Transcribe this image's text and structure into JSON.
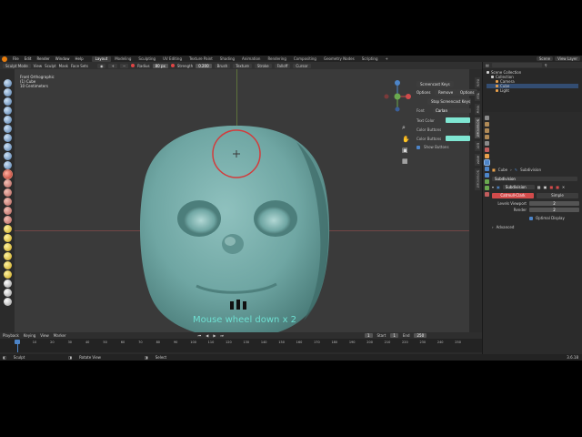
{
  "topbar": {
    "menu": [
      "File",
      "Edit",
      "Render",
      "Window",
      "Help"
    ],
    "workspaces": [
      "Layout",
      "Modeling",
      "Sculpting",
      "UV Editing",
      "Texture Paint",
      "Shading",
      "Animation",
      "Rendering",
      "Compositing",
      "Geometry Nodes",
      "Scripting"
    ],
    "active_workspace": "Layout",
    "scene": "Scene",
    "view_layer": "View Layer"
  },
  "viewport_header": {
    "mode": "Sculpt Mode",
    "menus": [
      "View",
      "Sculpt",
      "Mask",
      "Face Sets"
    ],
    "radius_label": "Radius",
    "radius_value": "80 px",
    "strength_label": "Strength",
    "strength_value": "0.200",
    "brush": "Brush",
    "texture": "Texture",
    "stroke": "Stroke",
    "falloff": "Falloff",
    "cursor": "Cursor"
  },
  "viewport": {
    "info_line1": "Front Orthographic",
    "info_line2": "(1) Cube",
    "info_line3": "10 Centimeters",
    "caption": "Mouse wheel down x 2"
  },
  "npanel": {
    "title": "Screencast Keys",
    "options": "Options",
    "remove": "Remove",
    "options2": "Options",
    "stop_button": "Stop Screencast Keys",
    "font_label": "Font",
    "font_value": "Carlan",
    "text_color_label": "Text Color",
    "text_color": "#7fe6d2",
    "color_buttons_label": "Color Buttons",
    "color_buttons": "#3a3a3a",
    "color_buttons2_label": "Color Buttons",
    "color_buttons2": "#7fe6d2",
    "show_buttons_label": "Show Buttons"
  },
  "side_tabs": [
    "Item",
    "Tool",
    "View",
    "Screencast",
    "Edit",
    "ANIM",
    "Screencast"
  ],
  "timeline": {
    "menus": [
      "Playback",
      "Keying",
      "View",
      "Marker"
    ],
    "current_frame": "1",
    "start_label": "Start",
    "start": "1",
    "end_label": "End",
    "end": "250",
    "ticks": [
      "10",
      "20",
      "30",
      "40",
      "50",
      "60",
      "70",
      "80",
      "90",
      "100",
      "110",
      "120",
      "130",
      "140",
      "150",
      "160",
      "170",
      "180",
      "190",
      "200",
      "210",
      "220",
      "230",
      "240",
      "250"
    ]
  },
  "statusbar": {
    "left": "Sculpt",
    "middle": "Rotate View",
    "right": "Select",
    "version": "3.6.18"
  },
  "outliner": {
    "header": "Scene Collection",
    "rows": [
      "Collection",
      "Camera",
      "Cube",
      "Light"
    ]
  },
  "properties": {
    "object": "Cube",
    "modifier_name": "Subdivision",
    "modifier_panel": "Subdivision",
    "tab_catmull": "Catmull-Clark",
    "tab_simple": "Simple",
    "levels_label": "Levels Viewport",
    "levels_value": "2",
    "render_label": "Render",
    "render_value": "2",
    "optimal_display": "Optimal Display",
    "advanced": "Advanced"
  },
  "colors": {
    "accent": "#e87d0d",
    "selection": "#4d85c9",
    "mesh": "#6fa6a3"
  }
}
